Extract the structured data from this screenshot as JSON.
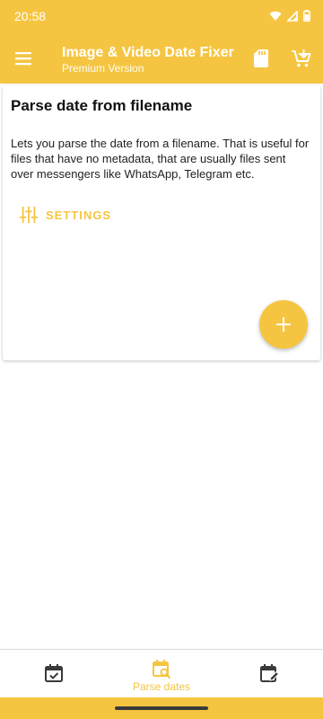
{
  "status_bar": {
    "time": "20:58",
    "icons": [
      "wifi-icon",
      "signal-icon",
      "battery-icon"
    ]
  },
  "app_bar": {
    "title": "Image & Video Date Fixer",
    "subtitle": "Premium Version",
    "left_icon": "menu-icon",
    "actions": [
      "sd-card-icon",
      "cart-add-icon"
    ]
  },
  "card": {
    "title": "Parse date from filename",
    "description": "Lets you parse the date from a filename. That is useful for files that have no metadata, that are usually files sent over messengers like WhatsApp, Telegram etc.",
    "settings_label": "SETTINGS",
    "settings_icon": "sliders-icon",
    "fab_icon": "plus-icon"
  },
  "bottom_nav": {
    "items": [
      {
        "icon": "calendar-check-icon",
        "label": ""
      },
      {
        "icon": "calendar-search-icon",
        "label": "Parse dates",
        "active": true
      },
      {
        "icon": "calendar-edit-icon",
        "label": ""
      }
    ]
  },
  "colors": {
    "accent": "#f5c542",
    "inactive_icon": "#3a3a3a"
  }
}
